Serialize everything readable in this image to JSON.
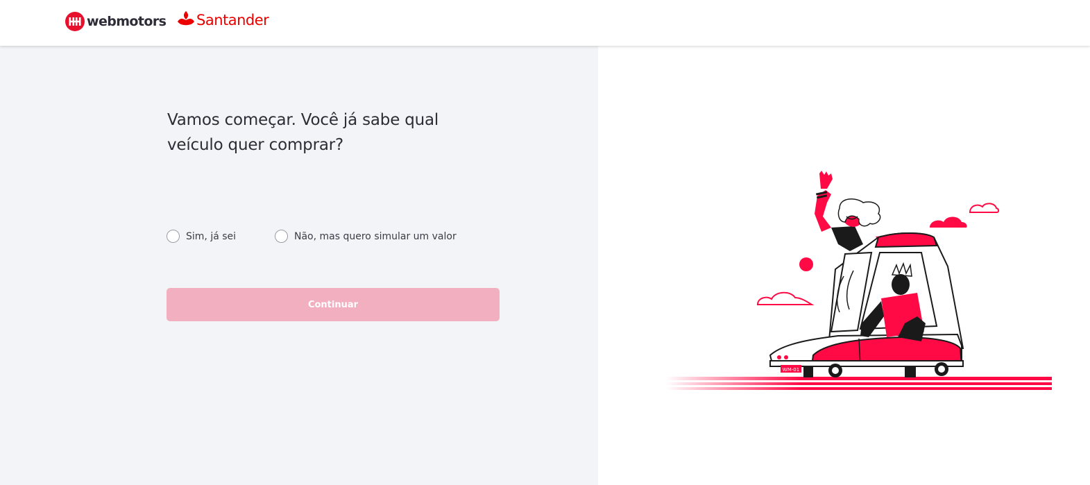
{
  "header": {
    "webmotors_logo_text": "webmotors",
    "santander_logo_text": "Santander"
  },
  "main": {
    "question": "Vamos começar. Você já sabe qual veículo quer comprar?",
    "options": [
      {
        "label": "Sim, já sei",
        "selected": false
      },
      {
        "label": "Não, mas quero simular um valor",
        "selected": false
      }
    ],
    "continue_label": "Continuar",
    "continue_disabled": true
  },
  "illustration": {
    "license_plate": "WM-01"
  },
  "colors": {
    "brand_red": "#e8112d",
    "santander_red": "#ec0000",
    "left_panel_bg": "#f3f4f7",
    "button_disabled": "#f2afc0",
    "text_dark": "#2e2d37"
  },
  "icons": {
    "webmotors_mark": "webmotors-logo-icon",
    "santander_flame": "santander-flame-icon",
    "radio": "radio-icon"
  }
}
